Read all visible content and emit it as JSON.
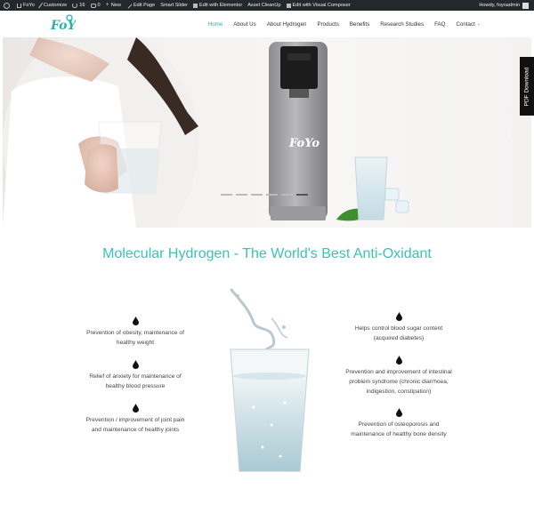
{
  "admin_bar": {
    "items": [
      {
        "icon": "wordpress-icon",
        "label": ""
      },
      {
        "icon": "home-icon",
        "label": "FoYo"
      },
      {
        "icon": "brush-icon",
        "label": "Customize"
      },
      {
        "icon": "refresh-icon",
        "label": "16"
      },
      {
        "icon": "comment-icon",
        "label": "0"
      },
      {
        "icon": "plus-icon",
        "label": "New"
      },
      {
        "icon": "pencil-icon",
        "label": "Edit Page"
      },
      {
        "icon": "",
        "label": "Smart Slider"
      },
      {
        "icon": "elementor-icon",
        "label": "Edit with Elementor"
      },
      {
        "icon": "",
        "label": "Asset CleanUp"
      },
      {
        "icon": "composer-icon",
        "label": "Edit with Visual Composer"
      }
    ],
    "greeting": "Howdy, foyoadmin"
  },
  "logo": {
    "text": "FoYo",
    "color": "#27b4ad"
  },
  "nav": {
    "items": [
      "Home",
      "About Us",
      "About Hydrogen",
      "Products",
      "Benefits",
      "Research Studies",
      "FAQ",
      "Contact"
    ],
    "active": "Home",
    "accent": "#27b4ad"
  },
  "hero": {
    "product_brand": "FoYo",
    "slides": 6,
    "active_slide": 6,
    "pdf_tab": "PDF Download"
  },
  "title": "Molecular Hydrogen - The World's Best Anti-Oxidant",
  "benefits_left": [
    {
      "line1": "Prevention of obesity, maintenance of",
      "line2": "healthy weight"
    },
    {
      "line1": "Relief of anxiety for maintenance of",
      "line2": "healthy blood pressure"
    },
    {
      "line1": "Prevention / improvement of joint pain",
      "line2": "and maintenance of healthy joints"
    }
  ],
  "benefits_right": [
    {
      "line1": "Helps control blood sugar content",
      "line2": "(acquired diabetes)"
    },
    {
      "line1": "Prevention and improvement of intestinal",
      "line2": "problem syndrome (chronic diarrhoea,",
      "line3": "indigestion, constipation)"
    },
    {
      "line1": "Prevention of osteoporosis and",
      "line2": "maintenance of healthy bone density"
    }
  ],
  "colors": {
    "teal": "#3cc2b8",
    "admin_bar": "#23282d"
  }
}
